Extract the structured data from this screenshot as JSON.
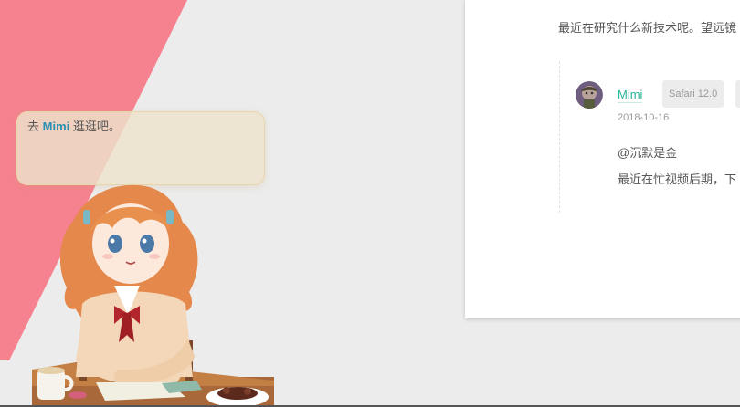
{
  "colors": {
    "page_background": "#ececec",
    "pink_band": "#f6828f",
    "accent_link": "#2bb39a",
    "tip_link": "#2a90b2",
    "tip_background": "#ede3cb"
  },
  "comment": {
    "parent_text": "最近在研究什么新技术呢。望远镜",
    "reply": {
      "author": "Mimi",
      "avatar_icon": "avatar-image",
      "badges": [
        "Safari 12.0",
        ""
      ],
      "date": "2018-10-16",
      "mention": "@沉默是金",
      "body": "最近在忙视频后期，下"
    }
  },
  "mascot": {
    "tip_prefix": "去 ",
    "tip_link": "Mimi",
    "tip_suffix": " 逛逛吧。"
  }
}
